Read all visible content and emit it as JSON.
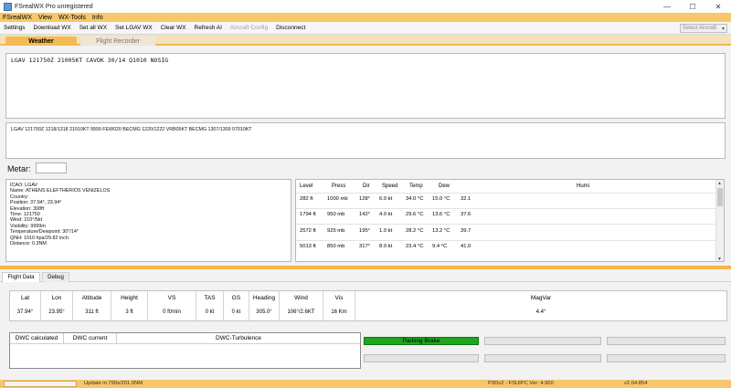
{
  "window": {
    "title": "FSrealWX Pro unregistered",
    "controls": {
      "minimize": "—",
      "maximize": "☐",
      "close": "✕"
    }
  },
  "menu": [
    "FSrealWX",
    "View",
    "WX-Tools",
    "Info"
  ],
  "toolbar": {
    "items": [
      {
        "label": "Settings",
        "enabled": true
      },
      {
        "label": "Download WX",
        "enabled": true
      },
      {
        "label": "Set all WX",
        "enabled": true
      },
      {
        "label": "Set LGAV WX",
        "enabled": true
      },
      {
        "label": "Clear WX",
        "enabled": true
      },
      {
        "label": "Refresh AI",
        "enabled": true
      },
      {
        "label": "Aircraft Config",
        "enabled": false
      },
      {
        "label": "Disconnect",
        "enabled": true
      }
    ],
    "select_aircraft": "Select Aircraft"
  },
  "tabs": {
    "weather": "Weather",
    "flight_recorder": "Flight Recorder"
  },
  "metar_text": "LGAV 121750Z 21005KT CAVOK 30/14 Q1010 NOSIG",
  "taf_text": "LGAV 121700Z 1218/1318 21010KT 9999 FEW020    BECMG 1220/1222 VRB05KT    BECMG 1307/1309 07010KT",
  "metar_label": "Metar:",
  "station_info": [
    "ICAO: LGAV",
    "Name: ATHENS ELEFTHERIOS VENIZELOS",
    "Country:",
    "Position: 37.94°, 23.94°",
    "Elevation: 308ft",
    "Time: 121750",
    "Wind: 210°/5kt",
    "Visibility: 9999m",
    "Temperature/Dewpoint: 30°/14°",
    "QNH: 1010 hpa/29.82 inch",
    "Distance: 0.3NM"
  ],
  "levels": {
    "headers": [
      "Level",
      "Press",
      "Dir",
      "Speed",
      "Temp",
      "Dew",
      "Humi"
    ],
    "rows": [
      [
        "282 ft",
        "1000 mb",
        "128°",
        "6.0 kt",
        "34.0 °C",
        "15.0 °C",
        "32.1"
      ],
      [
        "1794 ft",
        "950 mb",
        "142°",
        "4.0 kt",
        "29.6 °C",
        "13.6 °C",
        "37.6"
      ],
      [
        "2572 ft",
        "925 mb",
        "195°",
        "1.0 kt",
        "28.2 °C",
        "13.2 °C",
        "39.7"
      ],
      [
        "5013 ft",
        "850 mb",
        "317°",
        "8.0 kt",
        "23.4 °C",
        "9.4 °C",
        "41.0"
      ]
    ]
  },
  "bottom_tabs": {
    "flight_data": "Flight Data",
    "debug": "Debug"
  },
  "flight_data": [
    {
      "label": "Lat",
      "value": "37.94°"
    },
    {
      "label": "Lon",
      "value": "23.95°"
    },
    {
      "label": "Altitude",
      "value": "311 ft"
    },
    {
      "label": "Height",
      "value": "3 ft"
    },
    {
      "label": "VS",
      "value": "0 ft/min"
    },
    {
      "label": "TAS",
      "value": "0 kt"
    },
    {
      "label": "GS",
      "value": "0 kt"
    },
    {
      "label": "Heading",
      "value": "305.0°"
    },
    {
      "label": "Wind",
      "value": "106°/2.6KT"
    },
    {
      "label": "Vis",
      "value": "16 Km"
    },
    {
      "label": "MagVar",
      "value": "4.4°"
    }
  ],
  "dwc": {
    "calculated": "DWC calculated",
    "current": "DWC current",
    "turbulence": "DWC-Turbulence"
  },
  "indicators": {
    "parking_brake": "Parking Brake"
  },
  "status": {
    "update": "Update in 790s/201.0NM",
    "sim": "P3Dv2 - FSUIPC Ver: 4.960",
    "version": "v2.04.854"
  },
  "colors": {
    "accent": "#f4b54a",
    "menu_bg": "#f7c76a",
    "indicator_on": "#1ea51e"
  }
}
